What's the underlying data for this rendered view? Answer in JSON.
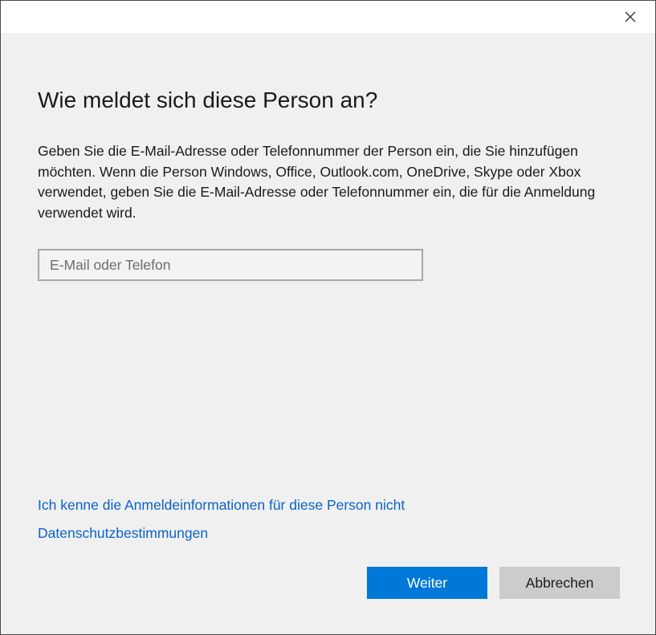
{
  "titlebar": {
    "close_icon": "close-icon"
  },
  "dialog": {
    "heading": "Wie meldet sich diese Person an?",
    "description": "Geben Sie die E-Mail-Adresse oder Telefonnummer der Person ein, die Sie hinzufügen möchten. Wenn die Person Windows, Office, Outlook.com, OneDrive, Skype oder Xbox verwendet, geben Sie die E-Mail-Adresse oder Telefonnummer ein, die für die Anmeldung verwendet wird.",
    "input": {
      "placeholder": "E-Mail oder Telefon",
      "value": ""
    },
    "links": {
      "unknown_info": "Ich kenne die Anmeldeinformationen für diese Person nicht",
      "privacy": "Datenschutzbestimmungen"
    },
    "buttons": {
      "next": "Weiter",
      "cancel": "Abbrechen"
    }
  },
  "colors": {
    "accent": "#0078d7",
    "link": "#0a63c8",
    "background": "#f0f0f0",
    "titlebar": "#ffffff",
    "secondary_button": "#cccccc"
  }
}
